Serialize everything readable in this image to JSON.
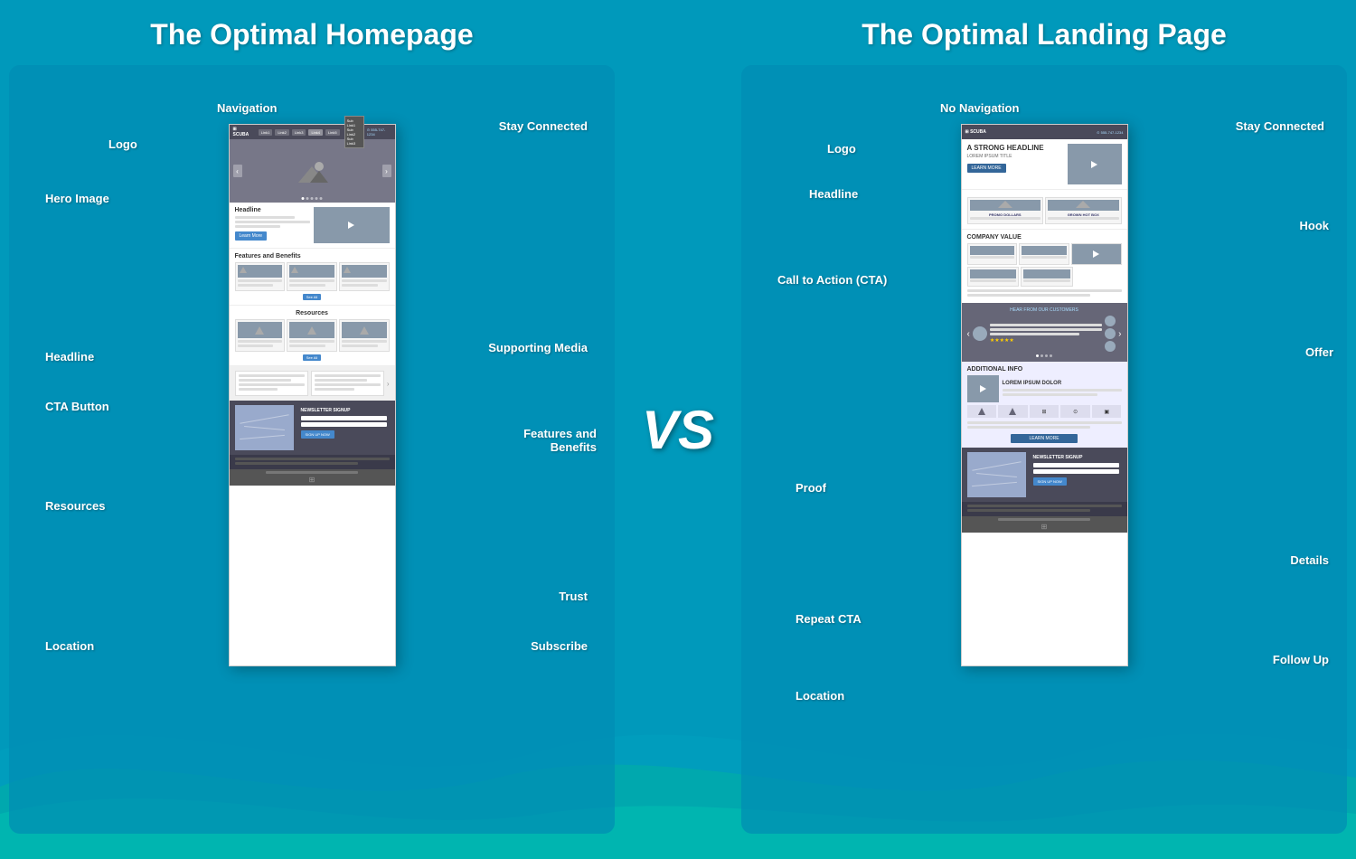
{
  "left": {
    "title": "The Optimal Homepage",
    "labels": {
      "navigation": "Navigation",
      "logo": "Logo",
      "hero_image": "Hero Image",
      "headline": "Headline",
      "cta_button": "CTA Button",
      "supporting_media": "Supporting Media",
      "features_benefits": "Features and\nBenefits",
      "resources": "Resources",
      "trust": "Trust",
      "subscribe": "Subscribe",
      "location": "Location"
    },
    "stay_connected": "Stay Connected"
  },
  "right": {
    "title": "The Optimal Landing Page",
    "labels": {
      "no_navigation": "No Navigation",
      "logo": "Logo",
      "headline": "Headline",
      "cta": "Call to Action (CTA)",
      "hook": "Hook",
      "offer": "Offer",
      "proof": "Proof",
      "details": "Details",
      "repeat_cta": "Repeat CTA",
      "follow_up": "Follow Up",
      "location": "Location"
    },
    "stay_connected": "Stay Connected"
  },
  "vs_text": "VS",
  "wireframe": {
    "navbar": {
      "logo": "⊞ SCUBA",
      "links": [
        "Link1",
        "Link2",
        "Link3",
        "Link4",
        "Link5"
      ],
      "phone": "555-747-1234"
    },
    "hero_headline": "Headline",
    "cta_learn_more": "Learn More",
    "features_title": "Features and Benefits",
    "resources_title": "Resources",
    "newsletter_title": "NEWSLETTER SIGNUP",
    "see_all": "See All"
  },
  "landing": {
    "strong_headline": "A STRONG HEADLINE",
    "subtitle": "LOREM IPSUM TITLE",
    "company_value_title": "COMPANY VALUE",
    "testimonial_title": "HEAR FROM OUR CUSTOMERS",
    "additional_info_title": "ADDITIONAL INFO",
    "newsletter_title": "NEWSLETTER SIGNUP",
    "learn_more": "LEARN MORE"
  }
}
